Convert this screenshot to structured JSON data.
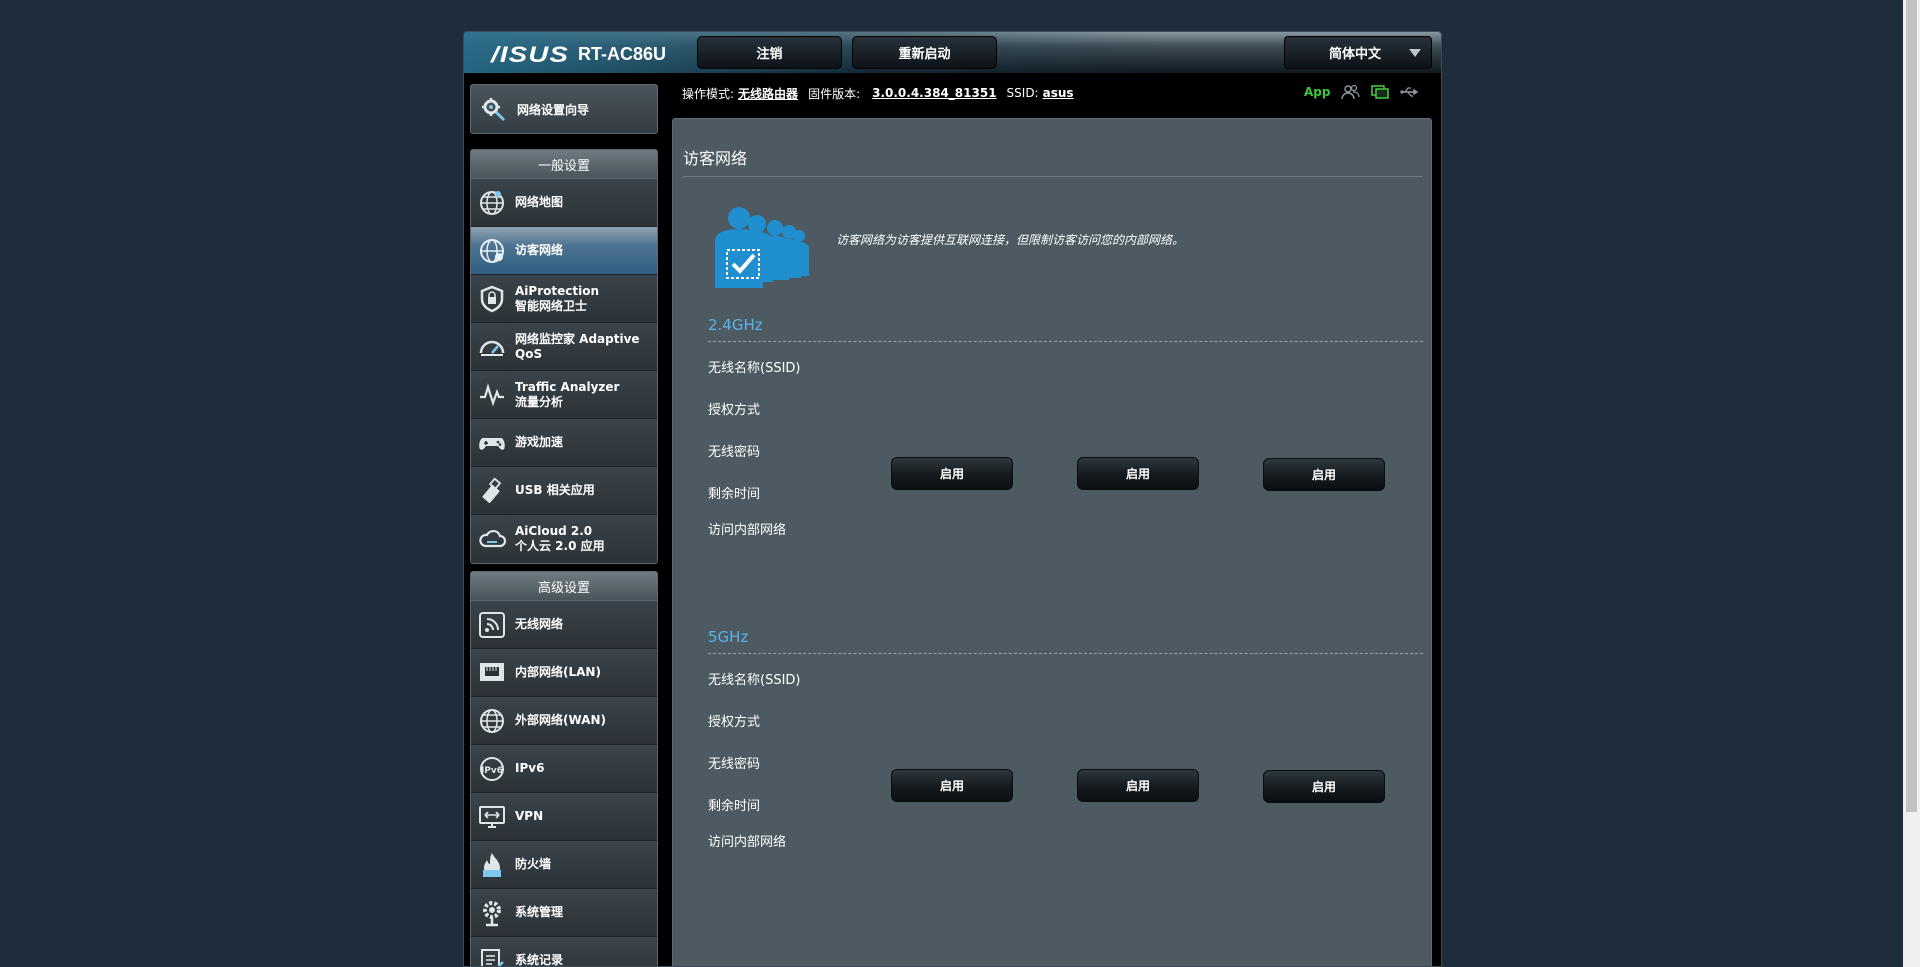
{
  "header": {
    "logo": "/ISUS",
    "model": "RT-AC86U",
    "logout_label": "注销",
    "reboot_label": "重新启动",
    "language": "简体中文"
  },
  "statusbar": {
    "mode_label": "操作模式:",
    "mode_value": "无线路由器",
    "firmware_label": "固件版本:",
    "firmware_value": "3.0.0.4.384_81351",
    "ssid_label": "SSID:",
    "ssid_value": "asus",
    "app_label": "App",
    "icons": [
      "users-icon",
      "network-status-icon",
      "usb-icon"
    ]
  },
  "sidebar": {
    "wizard": {
      "label": "网络设置向导",
      "icon": "wizard-icon"
    },
    "general": {
      "heading": "一般设置",
      "items": [
        {
          "line1": "网络地图",
          "line2": "",
          "icon": "network-map-icon"
        },
        {
          "line1": "访客网络",
          "line2": "",
          "icon": "guest-network-icon",
          "active": true
        },
        {
          "line1": "AiProtection",
          "line2": "智能网络卫士",
          "icon": "shield-icon"
        },
        {
          "line1": "网络监控家 Adaptive",
          "line2": "QoS",
          "icon": "gauge-icon"
        },
        {
          "line1": "Traffic Analyzer",
          "line2": "流量分析",
          "icon": "traffic-icon"
        },
        {
          "line1": "游戏加速",
          "line2": "",
          "icon": "gamepad-icon"
        },
        {
          "line1": "USB 相关应用",
          "line2": "",
          "icon": "usb-app-icon"
        },
        {
          "line1": "AiCloud 2.0",
          "line2": "个人云 2.0 应用",
          "icon": "cloud-icon"
        }
      ]
    },
    "advanced": {
      "heading": "高级设置",
      "items": [
        {
          "line1": "无线网络",
          "icon": "wireless-icon"
        },
        {
          "line1": "内部网络(LAN)",
          "icon": "lan-icon"
        },
        {
          "line1": "外部网络(WAN)",
          "icon": "wan-globe-icon"
        },
        {
          "line1": "IPv6",
          "icon": "ipv6-icon"
        },
        {
          "line1": "VPN",
          "icon": "vpn-icon"
        },
        {
          "line1": "防火墙",
          "icon": "firewall-icon"
        },
        {
          "line1": "系统管理",
          "icon": "admin-gear-icon"
        },
        {
          "line1": "系统记录",
          "icon": "log-icon"
        }
      ]
    }
  },
  "main": {
    "title": "访客网络",
    "description": "访客网络为访客提供互联网连接，但限制访客访问您的内部网络。",
    "bands": [
      {
        "name": "2.4GHz",
        "fields": [
          "无线名称(SSID)",
          "授权方式",
          "无线密码",
          "剩余时间",
          "访问内部网络"
        ],
        "buttons": [
          "启用",
          "启用",
          "启用"
        ]
      },
      {
        "name": "5GHz",
        "fields": [
          "无线名称(SSID)",
          "授权方式",
          "无线密码",
          "剩余时间",
          "访问内部网络"
        ],
        "buttons": [
          "启用",
          "启用",
          "启用"
        ]
      }
    ]
  },
  "colors": {
    "page_bg": "#1e2d3b",
    "content_bg": "#4d5a62",
    "band_title": "#58b4ea",
    "app_green": "#3fc43f",
    "active_item": "#2f5f82"
  }
}
